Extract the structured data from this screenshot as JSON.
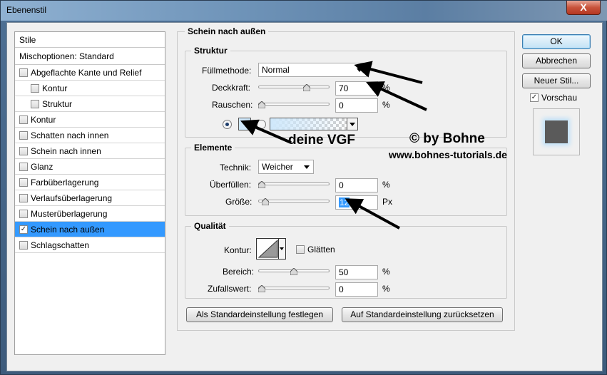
{
  "window": {
    "title": "Ebenenstil",
    "close_glyph": "X"
  },
  "sidebar": {
    "header": "Stile",
    "blend_header": "Mischoptionen: Standard",
    "items": [
      {
        "label": "Abgeflachte Kante und Relief",
        "checked": false,
        "sub": false
      },
      {
        "label": "Kontur",
        "checked": false,
        "sub": true
      },
      {
        "label": "Struktur",
        "checked": false,
        "sub": true
      },
      {
        "label": "Kontur",
        "checked": false,
        "sub": false
      },
      {
        "label": "Schatten nach innen",
        "checked": false,
        "sub": false
      },
      {
        "label": "Schein nach innen",
        "checked": false,
        "sub": false
      },
      {
        "label": "Glanz",
        "checked": false,
        "sub": false
      },
      {
        "label": "Farbüberlagerung",
        "checked": false,
        "sub": false
      },
      {
        "label": "Verlaufsüberlagerung",
        "checked": false,
        "sub": false
      },
      {
        "label": "Musterüberlagerung",
        "checked": false,
        "sub": false
      },
      {
        "label": "Schein nach außen",
        "checked": true,
        "sub": false,
        "selected": true
      },
      {
        "label": "Schlagschatten",
        "checked": false,
        "sub": false
      }
    ]
  },
  "panel": {
    "title": "Schein nach außen",
    "structure": {
      "title": "Struktur",
      "blend_mode_label": "Füllmethode:",
      "blend_mode_value": "Normal",
      "opacity_label": "Deckkraft:",
      "opacity_value": "70",
      "opacity_fraction": 0.7,
      "noise_label": "Rauschen:",
      "noise_value": "0",
      "noise_fraction": 0,
      "unit": "%"
    },
    "elements": {
      "title": "Elemente",
      "technique_label": "Technik:",
      "technique_value": "Weicher",
      "spread_label": "Überfüllen:",
      "spread_value": "0",
      "spread_fraction": 0,
      "size_label": "Größe:",
      "size_value": "12",
      "size_fraction": 0.05,
      "percent_unit": "%",
      "px_unit": "Px"
    },
    "quality": {
      "title": "Qualität",
      "contour_label": "Kontur:",
      "antialias_label": "Glätten",
      "antialias_checked": false,
      "range_label": "Bereich:",
      "range_value": "50",
      "range_fraction": 0.5,
      "jitter_label": "Zufallswert:",
      "jitter_value": "0",
      "jitter_fraction": 0,
      "unit": "%"
    },
    "make_default_label": "Als Standardeinstellung festlegen",
    "reset_default_label": "Auf Standardeinstellung zurücksetzen"
  },
  "actions": {
    "ok_label": "OK",
    "cancel_label": "Abbrechen",
    "new_style_label": "Neuer Stil...",
    "preview_label": "Vorschau",
    "preview_checked": true
  },
  "annotations": {
    "vgf_label": "deine VGF",
    "copyright_label": "© by Bohne",
    "website_label": "www.bohnes-tutorials.de"
  },
  "colors": {
    "glow_color": "#cfe8fb",
    "selection": "#3399ff"
  }
}
